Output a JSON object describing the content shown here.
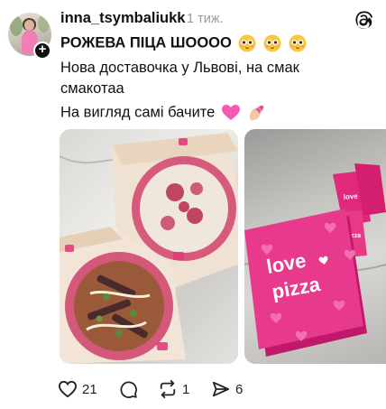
{
  "post": {
    "username": "inna_tsymbaliukk",
    "time": "1 тиж.",
    "lines": [
      "РОЖЕВА ПІЦА ШОООО",
      "Нова доставочка у Львові, на смак",
      "смакотаа",
      "На вигляд самі бачите"
    ],
    "emoji_line1": [
      "flushed-face-emoji",
      "flushed-face-emoji",
      "flushed-face-emoji"
    ],
    "emoji_line4": [
      "pink-heart-emoji",
      "nail-polish-emoji"
    ],
    "images": [
      {
        "name": "pizza-photo",
        "description_icon": "pizza"
      },
      {
        "name": "love-pizza-box-photo",
        "box_text_1": "love",
        "box_text_2": "pizza"
      }
    ],
    "actions": {
      "likes": "21",
      "comments": "",
      "reposts": "1",
      "shares": "6"
    }
  },
  "colors": {
    "text": "#111111",
    "muted": "#9a9a9a",
    "pink": "#e6217a"
  }
}
